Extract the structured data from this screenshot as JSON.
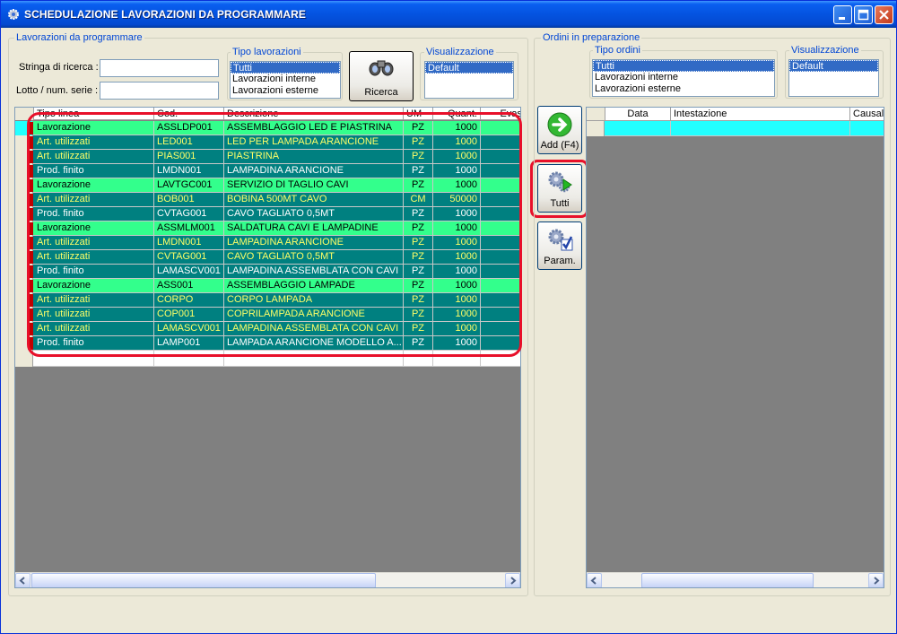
{
  "window": {
    "title": "SCHEDULAZIONE LAVORAZIONI DA PROGRAMMARE"
  },
  "left_panel": {
    "legend": "Lavorazioni da programmare",
    "search_label": "Stringa di ricerca :",
    "lotto_label": "Lotto / num. serie :",
    "tipo_legend": "Tipo lavorazioni",
    "tipo_options": [
      "Tutti",
      "Lavorazioni interne",
      "Lavorazioni esterne"
    ],
    "vis_legend": "Visualizzazione",
    "vis_options": [
      "Default"
    ],
    "search_button": "Ricerca",
    "columns": [
      "Tipo linea",
      "Cod.",
      "Descrizione",
      "UM",
      "Quant.",
      "Evas"
    ],
    "rows": [
      {
        "tipo": "Lavorazione",
        "cod": "ASSLDP001",
        "desc": "ASSEMBLAGGIO LED E PIASTRINA",
        "um": "PZ",
        "qty": "1000"
      },
      {
        "tipo": "Art. utilizzati",
        "cod": "LED001",
        "desc": "LED PER LAMPADA ARANCIONE",
        "um": "PZ",
        "qty": "1000"
      },
      {
        "tipo": "Art. utilizzati",
        "cod": "PIAS001",
        "desc": "PIASTRINA",
        "um": "PZ",
        "qty": "1000"
      },
      {
        "tipo": "Prod. finito",
        "cod": "LMDN001",
        "desc": "LAMPADINA ARANCIONE",
        "um": "PZ",
        "qty": "1000"
      },
      {
        "tipo": "Lavorazione",
        "cod": "LAVTGC001",
        "desc": "SERVIZIO DI TAGLIO CAVI",
        "um": "PZ",
        "qty": "1000"
      },
      {
        "tipo": "Art. utilizzati",
        "cod": "BOB001",
        "desc": "BOBINA 500MT CAVO",
        "um": "CM",
        "qty": "50000"
      },
      {
        "tipo": "Prod. finito",
        "cod": "CVTAG001",
        "desc": "CAVO TAGLIATO 0,5MT",
        "um": "PZ",
        "qty": "1000"
      },
      {
        "tipo": "Lavorazione",
        "cod": "ASSMLM001",
        "desc": "SALDATURA CAVI E LAMPADINE",
        "um": "PZ",
        "qty": "1000"
      },
      {
        "tipo": "Art. utilizzati",
        "cod": "LMDN001",
        "desc": "LAMPADINA ARANCIONE",
        "um": "PZ",
        "qty": "1000"
      },
      {
        "tipo": "Art. utilizzati",
        "cod": "CVTAG001",
        "desc": "CAVO TAGLIATO 0,5MT",
        "um": "PZ",
        "qty": "1000"
      },
      {
        "tipo": "Prod. finito",
        "cod": "LAMASCV001",
        "desc": "LAMPADINA ASSEMBLATA CON CAVI",
        "um": "PZ",
        "qty": "1000"
      },
      {
        "tipo": "Lavorazione",
        "cod": "ASS001",
        "desc": "ASSEMBLAGGIO LAMPADE",
        "um": "PZ",
        "qty": "1000"
      },
      {
        "tipo": "Art. utilizzati",
        "cod": "CORPO",
        "desc": "CORPO LAMPADA",
        "um": "PZ",
        "qty": "1000"
      },
      {
        "tipo": "Art. utilizzati",
        "cod": "COP001",
        "desc": "COPRILAMPADA ARANCIONE",
        "um": "PZ",
        "qty": "1000"
      },
      {
        "tipo": "Art. utilizzati",
        "cod": "LAMASCV001",
        "desc": "LAMPADINA ASSEMBLATA CON CAVI",
        "um": "PZ",
        "qty": "1000"
      },
      {
        "tipo": "Prod. finito",
        "cod": "LAMP001",
        "desc": "LAMPADA ARANCIONE MODELLO A...",
        "um": "PZ",
        "qty": "1000"
      }
    ]
  },
  "middle_buttons": {
    "add": "Add (F4)",
    "tutti": "Tutti",
    "param": "Param."
  },
  "right_panel": {
    "legend": "Ordini in preparazione",
    "tipo_legend": "Tipo ordini",
    "tipo_options": [
      "Tutti",
      "Lavorazioni interne",
      "Lavorazioni esterne"
    ],
    "vis_legend": "Visualizzazione",
    "vis_options": [
      "Default"
    ],
    "columns": [
      "Data",
      "Intestazione",
      "Causal"
    ]
  },
  "colors": {
    "lavorazione_bg": "#33ff8c",
    "art_bg": "#008080",
    "art_text": "#ffff66",
    "prod_bg": "#008080",
    "prod_text": "#ffffff",
    "highlight": "#e8102a"
  }
}
